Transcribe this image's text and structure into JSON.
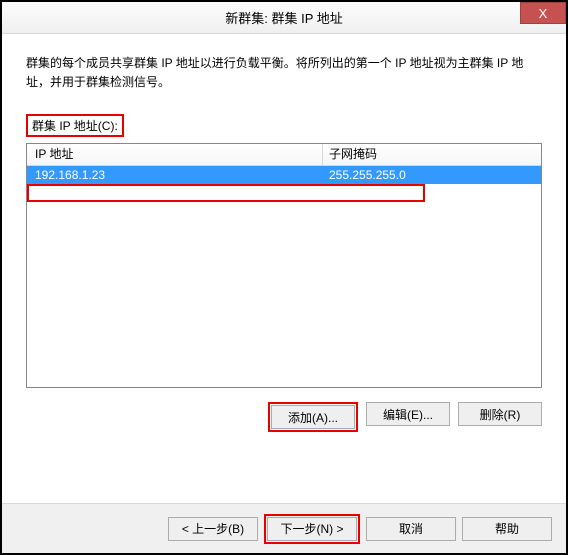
{
  "title": "新群集: 群集 IP 地址",
  "close_glyph": "X",
  "description": "群集的每个成员共享群集 IP 地址以进行负载平衡。将所列出的第一个 IP 地址视为主群集 IP 地址，并用于群集检测信号。",
  "section_label": "群集 IP 地址(C):",
  "table": {
    "headers": {
      "ip": "IP 地址",
      "subnet": "子网掩码"
    },
    "rows": [
      {
        "ip": "192.168.1.23",
        "subnet": "255.255.255.0"
      }
    ]
  },
  "buttons": {
    "add": "添加(A)...",
    "edit": "编辑(E)...",
    "remove": "删除(R)"
  },
  "footer": {
    "back": "< 上一步(B)",
    "next": "下一步(N) >",
    "cancel": "取消",
    "help": "帮助"
  }
}
